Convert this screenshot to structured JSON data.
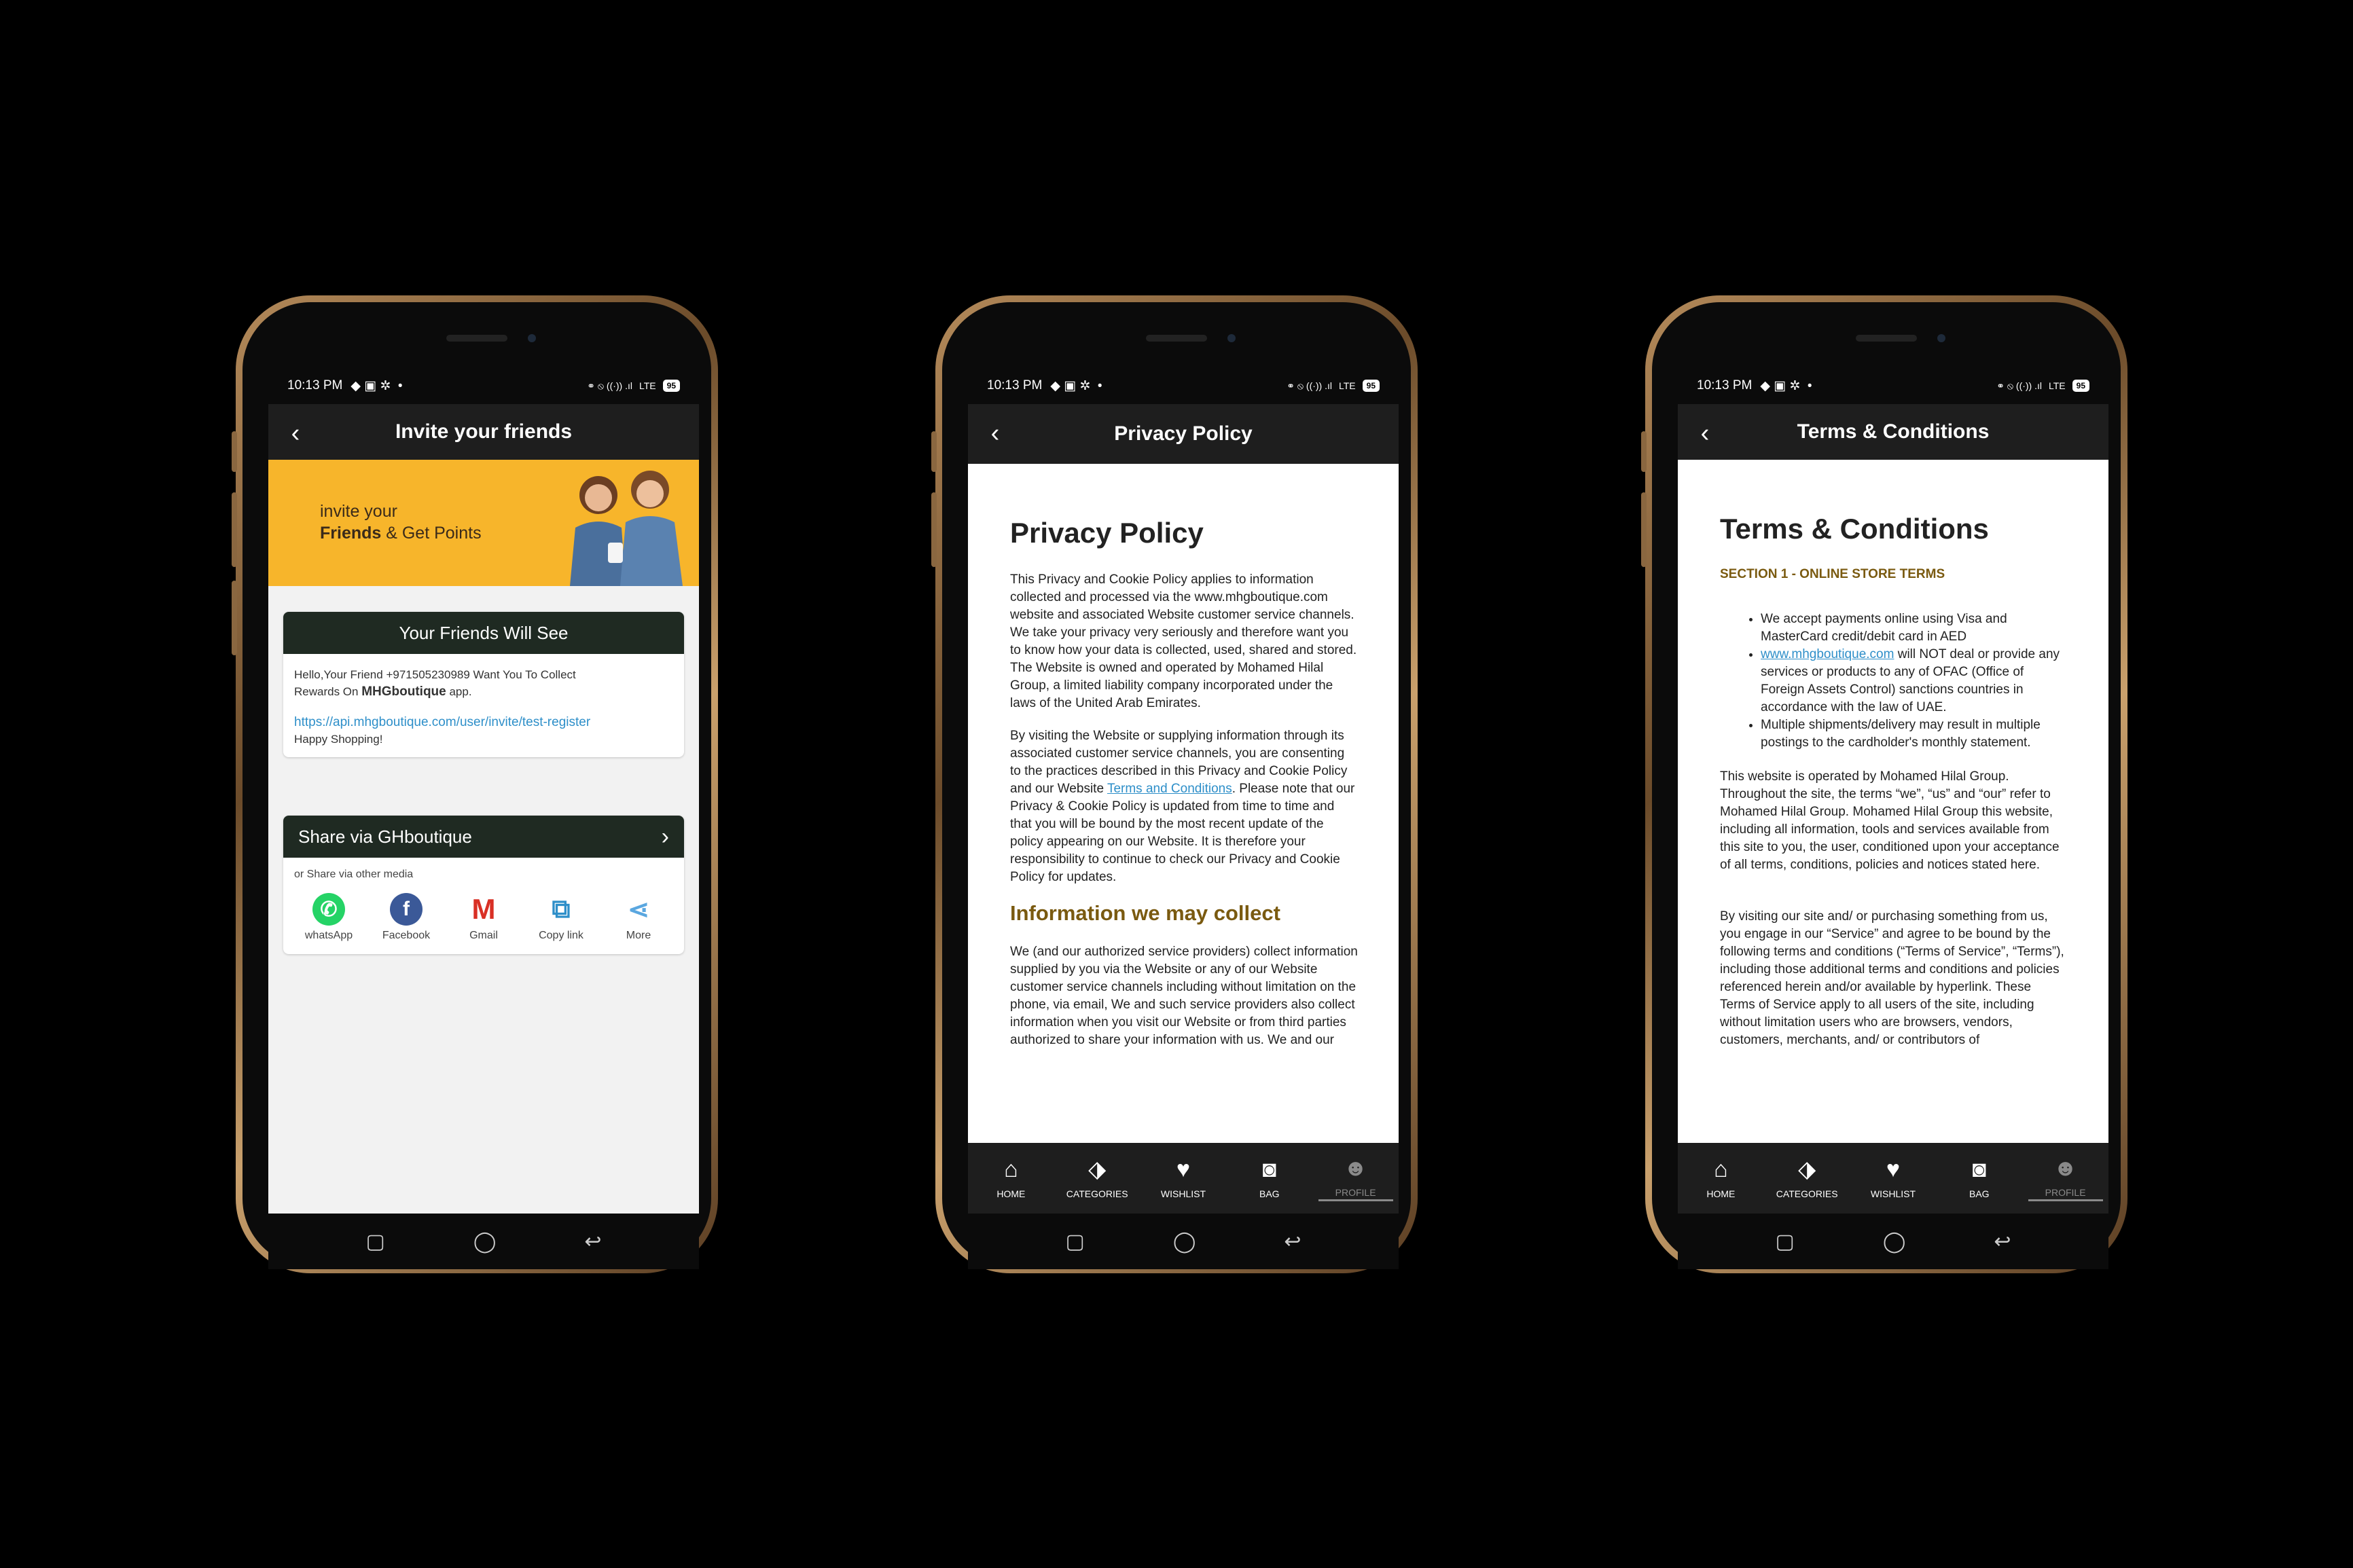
{
  "status": {
    "time": "10:13 PM",
    "battery": "95",
    "network": "LTE"
  },
  "nav": {
    "home": "HOME",
    "categories": "CATEGORIES",
    "wishlist": "WISHLIST",
    "bag": "BAG",
    "profile": "PROFILE"
  },
  "invite": {
    "title": "Invite your friends",
    "banner_line1": "invite your",
    "banner_bold": "Friends",
    "banner_rest": " & Get Points",
    "card_title": "Your Friends Will See",
    "msg_line1": "Hello,Your Friend +971505230989 Want You To Collect",
    "msg_line2a": "Rewards On ",
    "msg_brand": "MHGboutique",
    "msg_line2b": " app.",
    "msg_link": "https://api.mhgboutique.com/user/invite/test-register",
    "msg_end": "Happy Shopping!",
    "share_title": "Share via GHboutique",
    "share_other": "or Share via other media",
    "share_items": [
      {
        "label": "whatsApp",
        "color": "#25d366"
      },
      {
        "label": "Facebook",
        "color": "#3b5998"
      },
      {
        "label": "Gmail",
        "color": "#ffffff"
      },
      {
        "label": "Copy link",
        "color": "#2e8fc9"
      },
      {
        "label": "More",
        "color": "#ffffff"
      }
    ]
  },
  "privacy": {
    "appbar_title": "Privacy Policy",
    "heading": "Privacy Policy",
    "p1": "This Privacy and Cookie Policy applies to information collected and processed via the www.mhgboutique.com website and associated Website customer service channels. We take your privacy very seriously and therefore want you to know how your data is collected, used, shared and stored. The Website is owned and operated by Mohamed Hilal Group, a limited liability company incorporated under the laws of the United Arab Emirates.",
    "p2a": "By visiting the Website or supplying information through its associated customer service channels, you are consenting to the practices described in this Privacy and Cookie Policy and our Website ",
    "p2_link": "Terms and Conditions",
    "p2b": ". Please note that our Privacy & Cookie Policy is updated from time to time and that you will be bound by the most recent update of the policy appearing on our Website. It is therefore your responsibility to continue to check our Privacy and Cookie Policy for updates.",
    "h2": "Information we may collect",
    "p3": "We (and our authorized service providers) collect information supplied by you via the Website or any of our Website customer service channels including without limitation on the phone, via email, We and such service providers also collect information when you visit our Website or from third parties authorized to share your information with us. We and our"
  },
  "terms": {
    "appbar_title": "Terms & Conditions",
    "heading": "Terms & Conditions",
    "section": "SECTION 1 - ONLINE STORE TERMS",
    "b1": "We accept payments online using Visa and MasterCard credit/debit card in AED",
    "b2_link": "www.mhgboutique.com",
    "b2_rest": " will NOT deal or provide any services or products to any of OFAC (Office of Foreign Assets Control) sanctions countries in accordance with the law of UAE.",
    "b3": "Multiple shipments/delivery may result in multiple postings to the cardholder's monthly statement.",
    "p1": "This website is operated by Mohamed Hilal Group. Throughout the site, the terms “we”, “us” and “our” refer to Mohamed Hilal Group. Mohamed Hilal Group this website, including all information, tools and services available from this site to you, the user, conditioned upon your acceptance of all terms, conditions, policies and notices stated here.",
    "p2": "By visiting our site and/ or purchasing something from us, you engage in our “Service” and agree to be bound by the following terms and conditions (“Terms of Service”, “Terms”), including those additional terms and conditions and policies referenced herein and/or available by hyperlink. These Terms of Service apply to all users of the site, including without limitation users who are browsers, vendors, customers, merchants, and/ or contributors of"
  }
}
